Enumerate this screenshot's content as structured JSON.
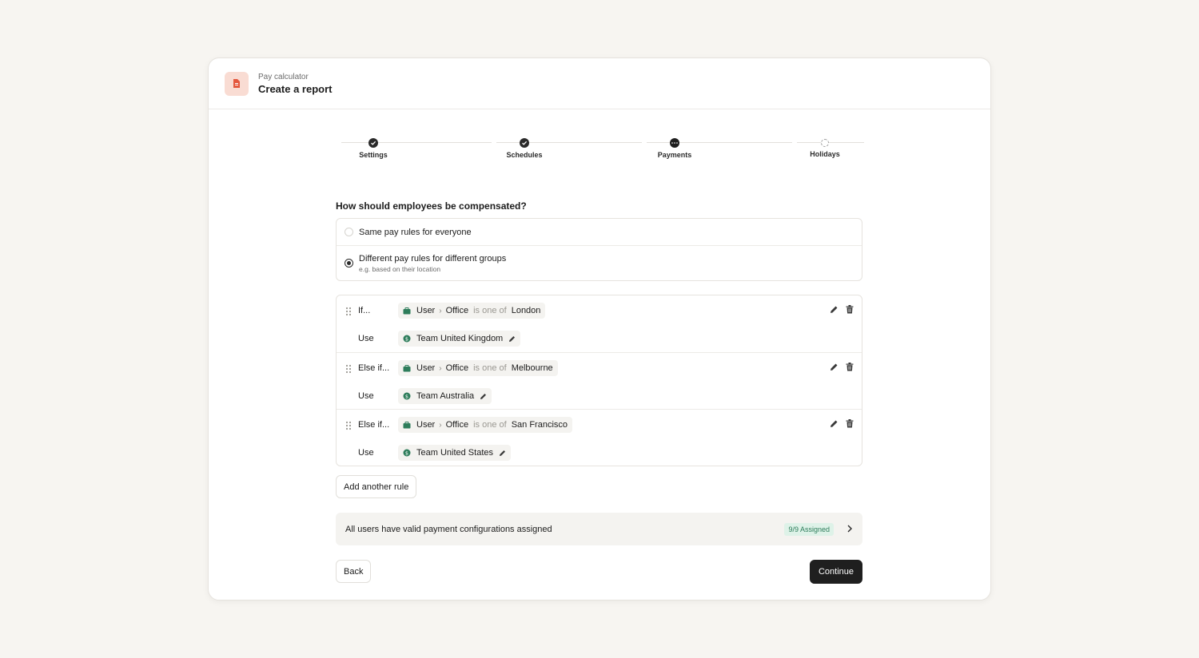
{
  "header": {
    "eyebrow": "Pay calculator",
    "title": "Create a report"
  },
  "stepper": {
    "steps": [
      {
        "label": "Settings",
        "state": "done"
      },
      {
        "label": "Schedules",
        "state": "done"
      },
      {
        "label": "Payments",
        "state": "current"
      },
      {
        "label": "Holidays",
        "state": "todo"
      }
    ]
  },
  "question": "How should employees be compensated?",
  "options": [
    {
      "label": "Same pay rules for everyone",
      "sublabel": "",
      "selected": false
    },
    {
      "label": "Different pay rules for different groups",
      "sublabel": "e.g. based on their location",
      "selected": true
    }
  ],
  "rules": [
    {
      "keyword": "If...",
      "entity": "User",
      "field": "Office",
      "operator": "is one of",
      "value": "London",
      "use_label": "Use",
      "team": "Team United Kingdom"
    },
    {
      "keyword": "Else if...",
      "entity": "User",
      "field": "Office",
      "operator": "is one of",
      "value": "Melbourne",
      "use_label": "Use",
      "team": "Team Australia"
    },
    {
      "keyword": "Else if...",
      "entity": "User",
      "field": "Office",
      "operator": "is one of",
      "value": "San Francisco",
      "use_label": "Use",
      "team": "Team United States"
    }
  ],
  "add_rule_label": "Add another rule",
  "summary": {
    "text": "All users have valid payment configurations assigned",
    "badge": "9/9 Assigned"
  },
  "footer": {
    "back_label": "Back",
    "continue_label": "Continue"
  },
  "colors": {
    "accent_green": "#2e7d5b",
    "brand_icon_bg": "#f9dcd3",
    "brand_icon_fg": "#e4583e",
    "primary_button": "#1f1f1f",
    "page_bg": "#f7f5f1"
  },
  "icons": {
    "app": "document-icon",
    "condition": "briefcase-icon",
    "team": "dollar-coin-icon",
    "edit": "pencil-icon",
    "delete": "trash-icon",
    "drag": "grip-icon",
    "summary": "chevron-right-icon"
  }
}
